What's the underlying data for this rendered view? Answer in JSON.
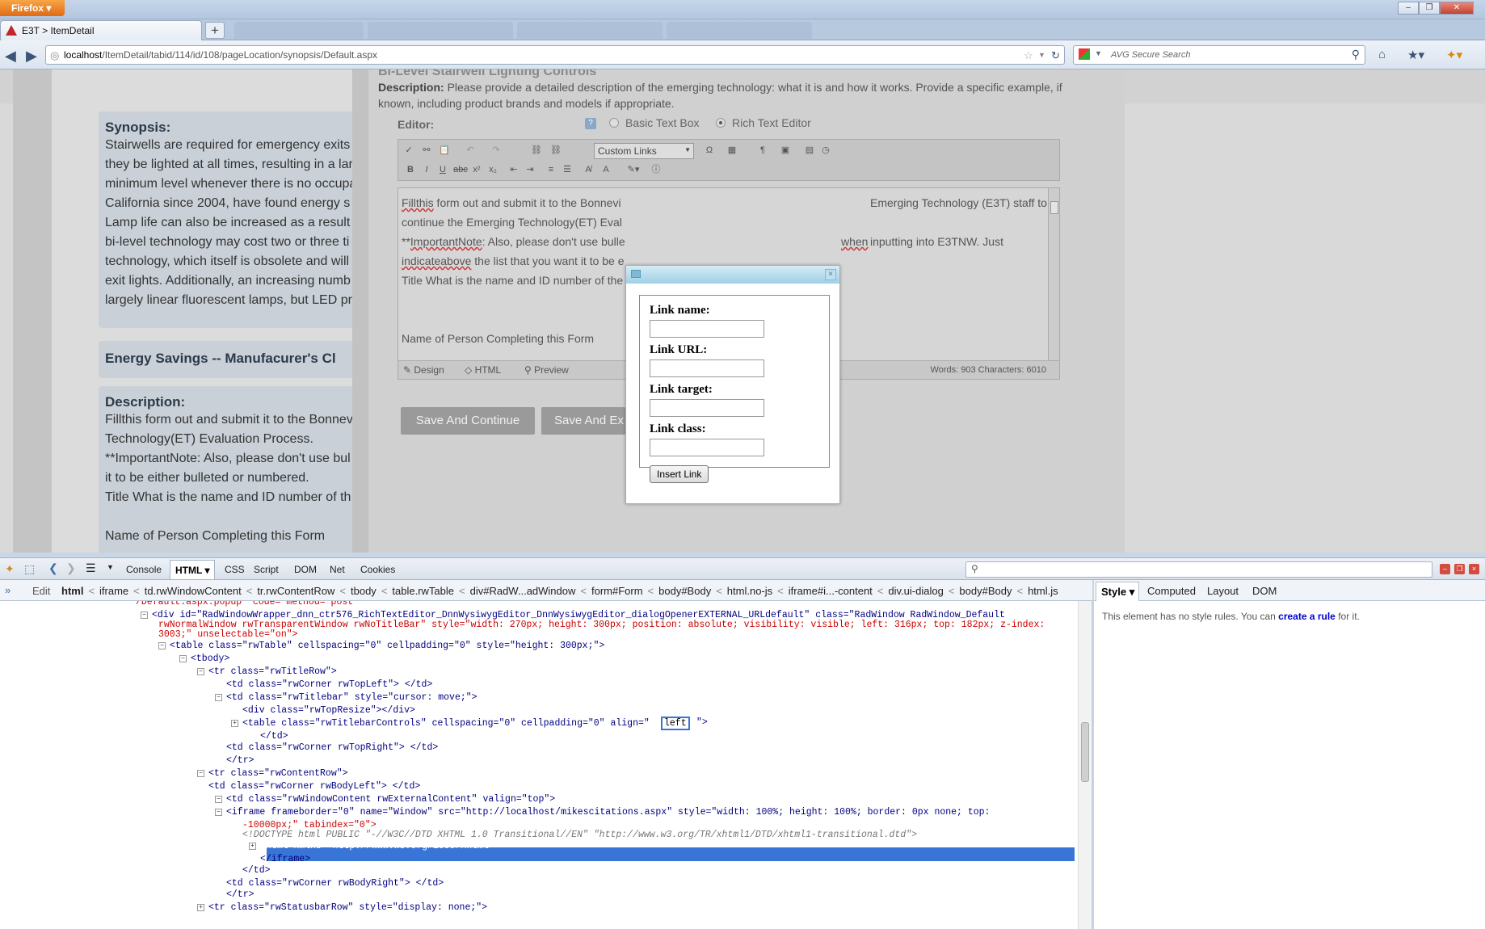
{
  "browser": {
    "app_button": "Firefox",
    "tab_title": "E3T > ItemDetail",
    "new_tab": "+",
    "url_host": "localhost",
    "url_path": "/ItemDetail/tabid/114/id/108/pageLocation/synopsis/Default.aspx",
    "search_placeholder": "AVG Secure Search"
  },
  "page": {
    "synopsis_heading": "Synopsis:",
    "synopsis_lines": [
      "Stairwells are required for emergency exits",
      "they be lighted at all times, resulting in a lar",
      "minimum level whenever there is no occupa",
      "California since 2004, have found energy s",
      "Lamp life can also be increased as a result",
      "bi-level technology may cost two or three ti",
      "technology, which itself is obsolete and will",
      "exit lights. Additionally, an increasing numb",
      "largely linear fluorescent lamps, but LED pr"
    ],
    "energy_heading": "Energy Savings -- Manufacurer's Cl",
    "description_heading": "Description:",
    "description_lines": [
      "Fillthis form out and submit it to the Bonnev",
      "Technology(ET) Evaluation Process.",
      "**ImportantNote: Also, please don't use bul",
      "it to be either bulleted or numbered.",
      "Title What is the name and ID number of th",
      "",
      "Name of Person Completing this Form"
    ]
  },
  "editor": {
    "faint_title": "Bi-Level Stairwell Lighting Controls",
    "desc_bold": "Description:",
    "desc_text": " Please provide a detailed description of the emerging technology: what it is and how it works. Provide a specific example, if known, including product brands and models if appropriate.",
    "editor_label": "Editor:",
    "basic_text_box": "Basic Text Box",
    "rich_text_editor": "Rich Text Editor",
    "custom_links": "Custom Links",
    "content_line1_a": "Fillthis",
    "content_line1_b": " form out and submit it to the Bonnevi",
    "content_line1_c": "Emerging Technology (E3T) staff to",
    "content_line2": "continue the Emerging Technology(ET) Eval",
    "content_line3_a": "**",
    "content_line3_b": "ImportantNote",
    "content_line3_c": ": Also, please don't use bulle",
    "content_line3_d": "when",
    "content_line3_e": " inputting into E3TNW. Just",
    "content_line4_a": "indicateabove",
    "content_line4_b": " the list that you want it to be e",
    "content_line5": "Title What is the name and ID number of the",
    "content_line6": "Name of Person Completing this Form",
    "mode_design": "Design",
    "mode_html": "HTML",
    "mode_preview": "Preview",
    "counts": "Words: 903   Characters: 6010",
    "save_continue": "Save And Continue",
    "save_exit": "Save And Ex"
  },
  "dialog": {
    "link_name": "Link name:",
    "link_url": "Link URL:",
    "link_target": "Link target:",
    "link_class": "Link class:",
    "insert_link": "Insert Link"
  },
  "firebug": {
    "tabs": [
      "Console",
      "HTML",
      "CSS",
      "Script",
      "DOM",
      "Net",
      "Cookies"
    ],
    "edit": "Edit",
    "breadcrumbs": [
      "html",
      "iframe",
      "td.rwWindowContent",
      "tr.rwContentRow",
      "tbody",
      "table.rwTable",
      "div#RadW...adWindow",
      "form#Form",
      "body#Body",
      "html.no-js",
      "iframe#i...-content",
      "div.ui-dialog",
      "body#Body",
      "html.js"
    ],
    "side_tabs": [
      "Style",
      "Computed",
      "Layout",
      "DOM"
    ],
    "side_message_a": "This element has no style rules. You can ",
    "side_message_link": "create a rule",
    "side_message_b": " for it."
  },
  "html_tree": [
    "/Default.aspx.popup\" code=\"method=\"post\"",
    "<div id=\"RadWindowWrapper_dnn_ctr576_RichTextEditor_DnnWysiwygEditor_DnnWysiwygEditor_dialogOpenerEXTERNAL_URLdefault\" class=\"RadWindow RadWindow_Default",
    "rwNormalWindow rwTransparentWindow rwNoTitleBar\" style=\"width: 270px; height: 300px; position: absolute; visibility: visible; left: 316px; top: 182px; z-index:",
    "3003;\" unselectable=\"on\">",
    "<table class=\"rwTable\" cellspacing=\"0\" cellpadding=\"0\" style=\"height: 300px;\">",
    "<tbody>",
    "<tr class=\"rwTitleRow\">",
    "<td class=\"rwCorner rwTopLeft\"> </td>",
    "<td class=\"rwTitlebar\" style=\"cursor: move;\">",
    "<div class=\"rwTopResize\"></div>",
    "<table class=\"rwTitlebarControls\" cellspacing=\"0\" cellpadding=\"0\" align=\"",
    "</td>",
    "<td class=\"rwCorner rwTopRight\"> </td>",
    "</tr>",
    "<tr class=\"rwContentRow\">",
    "<td class=\"rwCorner rwBodyLeft\"> </td>",
    "<td class=\"rwWindowContent rwExternalContent\" valign=\"top\">",
    "<iframe frameborder=\"0\" name=\"Window\" src=\"http://localhost/mikescitations.aspx\" style=\"width: 100%; height: 100%; border: 0px none; top:",
    "-10000px;\" tabindex=\"0\">",
    "<!DOCTYPE html PUBLIC \"-//W3C//DTD XHTML 1.0 Transitional//EN\" \"http://www.w3.org/TR/xhtml1/DTD/xhtml1-transitional.dtd\">",
    "<html xmlns=\"http://www.w3.org/1999/xhtml\">",
    "</iframe>",
    "</td>",
    "<td class=\"rwCorner rwBodyRight\"> </td>",
    "</tr>",
    "<tr class=\"rwStatusbarRow\" style=\"display: none;\">"
  ],
  "html_tree_edit_value": "left",
  "html_tree_close": "\">",
  "colors": {
    "selection": "#3875d7",
    "attr_value": "#cc0000",
    "tag": "#000088"
  }
}
